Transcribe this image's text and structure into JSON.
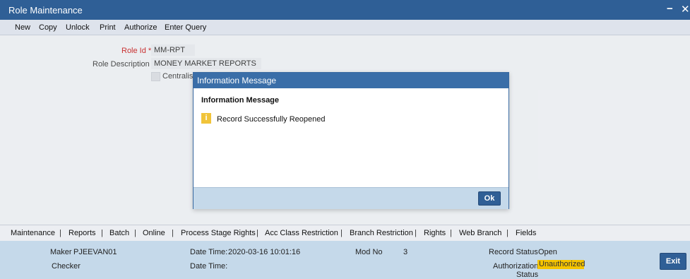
{
  "window": {
    "title": "Role Maintenance",
    "minimize_label": "−",
    "close_label": "✕"
  },
  "menubar": {
    "items": [
      "New",
      "Copy",
      "Unlock",
      "Print",
      "Authorize",
      "Enter Query"
    ]
  },
  "form": {
    "role_id_label": "Role Id",
    "required_marker": "*",
    "role_id_value": "MM-RPT",
    "role_description_label": "Role Description",
    "role_description_value": "MONEY MARKET REPORTS",
    "centralised_label": "Centralisa"
  },
  "dialog": {
    "title": "Information Message",
    "heading": "Information Message",
    "icon": "info-icon",
    "icon_glyph": "i",
    "message": "Record Successfully Reopened",
    "ok_label": "Ok"
  },
  "tabs": {
    "items": [
      "Maintenance",
      "Reports",
      "Batch",
      "Online",
      "Process Stage Rights",
      "Acc Class Restriction",
      "Branch Restriction",
      "Rights",
      "Web Branch",
      "Fields"
    ],
    "separator": "|"
  },
  "status": {
    "maker_label": "Maker",
    "maker_value": "PJEEVAN01",
    "checker_label": "Checker",
    "datetime_label": "Date Time:",
    "maker_datetime": "2020-03-16 10:01:16",
    "checker_datetime_label": "Date Time:",
    "mod_no_label": "Mod No",
    "mod_no_value": "3",
    "record_status_label": "Record Status",
    "record_status_value": "Open",
    "authorization_label": "Authorization",
    "authorization_label_line2": "Status",
    "authorization_value": "Unauthorized",
    "exit_label": "Exit"
  },
  "colors": {
    "titlebar": "#2f5f96",
    "dialog_title": "#3a6ea8",
    "status_bg": "#c5d9ea",
    "unauthorized_badge": "#f5c400",
    "required": "#c00000"
  }
}
